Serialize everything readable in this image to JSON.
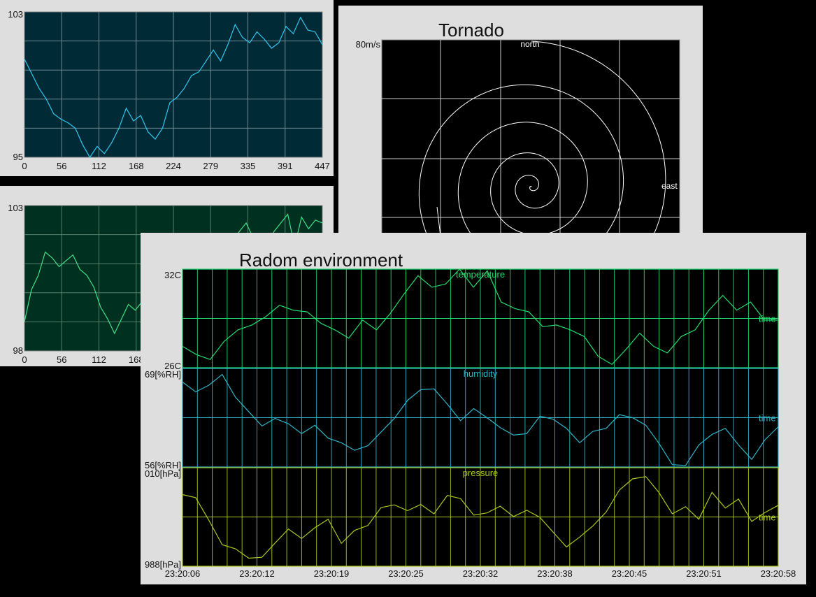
{
  "chart_data": [
    {
      "id": "series_a",
      "type": "line",
      "title": "",
      "ylim": [
        95,
        103
      ],
      "xlim": [
        0,
        447
      ],
      "y_ticks": [
        "103",
        "95"
      ],
      "x_ticks": [
        "0",
        "56",
        "112",
        "168",
        "224",
        "279",
        "335",
        "391",
        "447"
      ],
      "grid": true,
      "colors": {
        "plot_bg": "#002a36",
        "line": "#2ec8ef",
        "grid": "#6f8a93"
      },
      "values": [
        100.4,
        99.6,
        98.8,
        98.2,
        97.4,
        97.1,
        96.9,
        96.6,
        95.7,
        95.0,
        95.6,
        95.2,
        95.8,
        96.6,
        97.7,
        97.0,
        97.3,
        96.4,
        96.0,
        96.6,
        98.0,
        98.3,
        98.8,
        99.5,
        99.7,
        100.3,
        100.9,
        100.3,
        101.2,
        102.3,
        101.6,
        101.3,
        101.9,
        101.5,
        101.0,
        101.3,
        102.2,
        101.8,
        102.7,
        102.0,
        101.9,
        101.2
      ],
      "series": [
        {
          "values_ref": "values"
        }
      ]
    },
    {
      "id": "series_b",
      "type": "line",
      "title": "",
      "ylim": [
        98,
        103
      ],
      "xlim": [
        0,
        447
      ],
      "y_ticks": [
        "103",
        "98"
      ],
      "x_ticks": [
        "0",
        "56",
        "112",
        "168"
      ],
      "grid": true,
      "colors": {
        "plot_bg": "#003020",
        "line": "#3ee08a",
        "grid": "#56806c"
      },
      "values": [
        99.0,
        100.1,
        100.6,
        101.4,
        101.2,
        100.9,
        101.1,
        101.3,
        100.8,
        100.6,
        100.2,
        99.5,
        99.1,
        98.6,
        99.1,
        99.6,
        99.4,
        99.7,
        99.2,
        99.6,
        99.7,
        100.2,
        100.6,
        100.4,
        101.1,
        101.4,
        100.7,
        100.3,
        100.9,
        101.6,
        101.8,
        102.1,
        102.4,
        101.9,
        100.8,
        101.3,
        102.1,
        102.4,
        102.7,
        101.6,
        102.6,
        102.2,
        102.5,
        102.4
      ],
      "series": [
        {
          "values_ref": "values"
        }
      ]
    },
    {
      "id": "tornado",
      "type": "line",
      "title": "Tornado",
      "rlim": [
        0,
        80
      ],
      "r_label": "80m/s",
      "direction_labels": {
        "north": "north",
        "east": "east"
      },
      "grid": true,
      "colors": {
        "plot_bg": "#000000",
        "line": "#ffffff",
        "grid": "#cccccc"
      },
      "spiral": {
        "turns": 5.0,
        "max_speed": 80
      }
    },
    {
      "id": "radom",
      "type": "line",
      "title": "Radom environment",
      "x_ticks": [
        "23:20:06",
        "23:20:12",
        "23:20:19",
        "23:20:25",
        "23:20:32",
        "23:20:38",
        "23:20:45",
        "23:20:51",
        "23:20:58"
      ],
      "grid": true,
      "panels": [
        {
          "name": "temperature",
          "ylim": [
            26,
            32
          ],
          "y_top_label": "32C",
          "y_bottom_label": "26C",
          "right_label": "time",
          "colors": {
            "line": "#22dc6e",
            "grid": "#22dc6e",
            "text": "#22dc6e"
          },
          "values": [
            27.3,
            26.8,
            26.5,
            27.6,
            28.3,
            28.6,
            29.1,
            29.8,
            29.5,
            29.4,
            28.7,
            28.3,
            27.8,
            28.9,
            28.3,
            29.3,
            30.5,
            31.6,
            30.9,
            31.1,
            32.0,
            30.9,
            31.9,
            30.0,
            29.6,
            29.4,
            28.5,
            28.6,
            28.3,
            27.9,
            26.7,
            26.2,
            27.1,
            28.1,
            27.3,
            26.9,
            27.9,
            28.3,
            29.5,
            30.4,
            29.5,
            30.0,
            28.9,
            28.9
          ]
        },
        {
          "name": "humidity",
          "ylim": [
            56,
            69
          ],
          "y_top_label": "69[%RH]",
          "y_bottom_label": "56[%RH]",
          "right_label": "time",
          "colors": {
            "line": "#2fb5c8",
            "grid": "#2fb5c8",
            "text": "#2fb5c8"
          },
          "values": [
            67.2,
            65.9,
            66.8,
            68.2,
            65.2,
            63.3,
            61.4,
            62.4,
            61.7,
            60.4,
            61.5,
            59.8,
            59.2,
            58.2,
            58.8,
            60.6,
            62.4,
            64.8,
            66.2,
            66.3,
            64.3,
            62.1,
            63.7,
            62.5,
            61.2,
            60.2,
            60.4,
            62.7,
            62.3,
            61.1,
            59.2,
            60.7,
            61.1,
            62.9,
            62.5,
            61.5,
            59.1,
            56.3,
            56.2,
            58.9,
            60.3,
            61.1,
            58.9,
            57.0,
            59.6,
            61.3
          ]
        },
        {
          "name": "pressure",
          "ylim": [
            988,
            1010
          ],
          "y_top_label": "010[hPa]",
          "y_bottom_label": "988[hPa]",
          "right_label": "time",
          "colors": {
            "line": "#a8c820",
            "grid": "#a8c820",
            "text": "#a8c820"
          },
          "values": [
            1004.0,
            1003.3,
            998.2,
            992.8,
            991.9,
            989.8,
            990.0,
            993.2,
            996.3,
            994.2,
            996.6,
            998.5,
            993.1,
            996.0,
            997.1,
            1001.1,
            1001.7,
            1000.4,
            1001.8,
            999.7,
            1003.8,
            1003.1,
            999.4,
            999.9,
            1001.4,
            999.1,
            1000.5,
            998.9,
            995.6,
            992.3,
            994.5,
            997.0,
            1000.1,
            1005.0,
            1007.5,
            1008.0,
            1004.4,
            999.7,
            1001.3,
            998.5,
            1004.5,
            1001.0,
            1003.0,
            998.0,
            1000.0,
            1001.6
          ]
        }
      ]
    }
  ]
}
